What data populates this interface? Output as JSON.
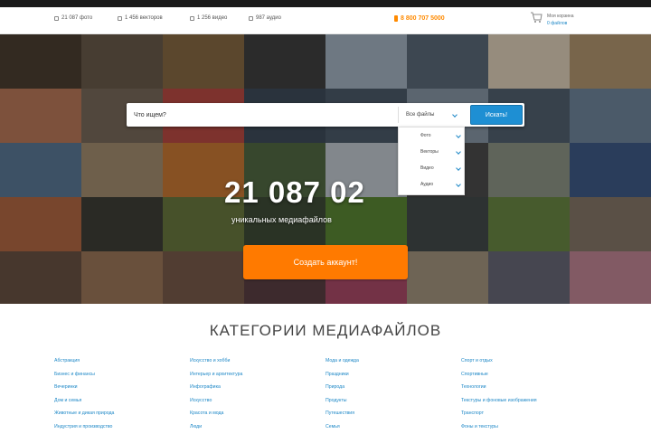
{
  "header": {
    "stats": [
      {
        "icon": "photo-icon",
        "label": "21 087 фото"
      },
      {
        "icon": "image-icon",
        "label": "1 456 векторов"
      },
      {
        "icon": "music-icon",
        "label": "1 256 видео"
      },
      {
        "icon": "file-icon",
        "label": "987 аудио"
      }
    ],
    "phone": "8 800 707 5000",
    "cart": {
      "label": "Моя корзина",
      "value": "0 файлов"
    }
  },
  "hero": {
    "tile_colors": [
      "#4a3a2c",
      "#6a5a48",
      "#8a6a40",
      "#3c3c3c",
      "#a8b8c8",
      "#5a6a7a",
      "#e8d8c0",
      "#b89a70",
      "#c07a58",
      "#7a6a5a",
      "#c04840",
      "#3a4a5a",
      "#4a5a6a",
      "#8a9aaa",
      "#506070",
      "#7088a0",
      "#5a7a9a",
      "#a89070",
      "#d07a30",
      "#506a40",
      "#c8d0d8",
      "#4a4a4a",
      "#909888",
      "#3a5a8a",
      "#b86840",
      "#3a3a32",
      "#6a7a3a",
      "#3a4a32",
      "#5a8a30",
      "#404848",
      "#6a8a40",
      "#887868",
      "#6a5040",
      "#a07858",
      "#7a5a48",
      "#5a3a40",
      "#b04868",
      "#a89880",
      "#686878",
      "#c88898"
    ],
    "search": {
      "placeholder": "Что ищем?",
      "type_selected": "Все файлы",
      "button_label": "Искать!"
    },
    "dropdown_items": [
      "Фото",
      "Векторы",
      "Видео",
      "Аудио"
    ],
    "counter": "21 087 02",
    "counter_subtitle": "уникальных медиафайлов",
    "cta_label": "Создать аккаунт!"
  },
  "categories": {
    "title": "КАТЕГОРИИ МЕДИАФАЙЛОВ",
    "columns": [
      [
        "Абстракция",
        "Бизнес и финансы",
        "Вечеринки",
        "Дом и семья",
        "Животные и дикая природа",
        "Индустрия и производство"
      ],
      [
        "Искусство и хобби",
        "Интерьер и архитектура",
        "Инфографика",
        "Искусство",
        "Красота и мода",
        "Люди"
      ],
      [
        "Мода и одежда",
        "Праздники",
        "Природа",
        "Продукты",
        "Путешествия",
        "Семья"
      ],
      [
        "Спорт и отдых",
        "Спортивные",
        "Технологии",
        "Текстуры и фоновые изображения",
        "Транспорт",
        "Фоны и текстуры"
      ]
    ]
  }
}
